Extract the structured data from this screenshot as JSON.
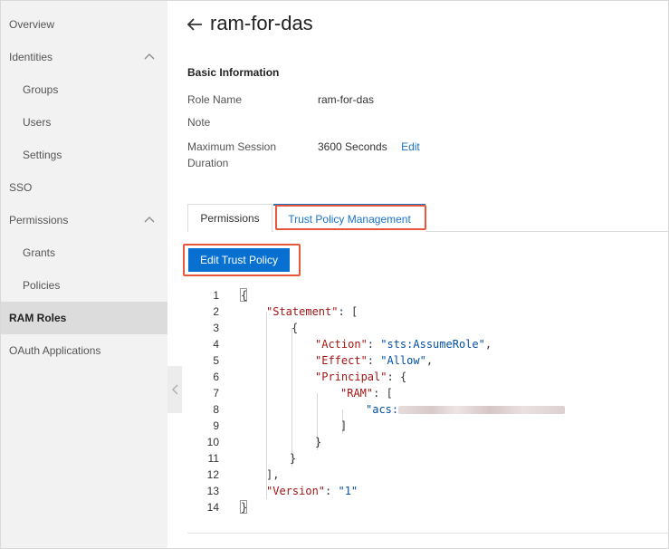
{
  "sidebar": {
    "items": [
      {
        "label": "Overview"
      },
      {
        "label": "Identities"
      },
      {
        "label": "Groups"
      },
      {
        "label": "Users"
      },
      {
        "label": "Settings"
      },
      {
        "label": "SSO"
      },
      {
        "label": "Permissions"
      },
      {
        "label": "Grants"
      },
      {
        "label": "Policies"
      },
      {
        "label": "RAM Roles"
      },
      {
        "label": "OAuth Applications"
      }
    ],
    "active": "RAM Roles"
  },
  "header": {
    "title": "ram-for-das"
  },
  "basic_info": {
    "section_title": "Basic Information",
    "role_name_label": "Role Name",
    "role_name_value": "ram-for-das",
    "note_label": "Note",
    "max_session_label_line1": "Maximum Session",
    "max_session_label_line2": "Duration",
    "max_session_value": "3600 Seconds",
    "edit_link": "Edit"
  },
  "tabs": [
    {
      "label": "Permissions"
    },
    {
      "label": "Trust Policy Management",
      "active": true
    }
  ],
  "edit_button": "Edit Trust Policy",
  "code": {
    "line_numbers": [
      "1",
      "2",
      "3",
      "4",
      "5",
      "6",
      "7",
      "8",
      "9",
      "10",
      "11",
      "12",
      "13",
      "14"
    ],
    "brace_open": "{",
    "statement_key": "\"Statement\"",
    "bracket_open": "[",
    "action_key": "\"Action\"",
    "action_val": "\"sts:AssumeRole\"",
    "effect_key": "\"Effect\"",
    "effect_val": "\"Allow\"",
    "principal_key": "\"Principal\"",
    "ram_key": "\"RAM\"",
    "acs_prefix": "\"acs:",
    "bracket_close": "]",
    "brace_close": "}",
    "bracket_close_comma": "],",
    "version_key": "\"Version\"",
    "version_val": "\"1\""
  },
  "colors": {
    "accent": "#0870d1",
    "highlight": "#e8573c",
    "sidebar_bg": "#f2f2f2",
    "active_bg": "#dcdcdc"
  }
}
